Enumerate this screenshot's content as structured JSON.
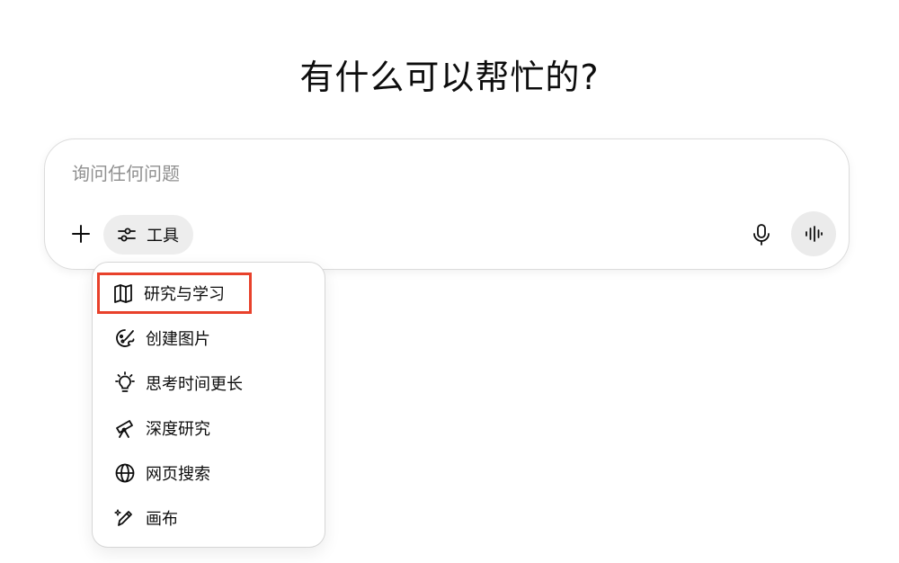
{
  "title": "有什么可以帮忙的?",
  "composer": {
    "placeholder": "询问任何问题",
    "value": "",
    "plus_icon": "plus-icon",
    "tools_label": "工具",
    "tools_icon": "sliders-icon",
    "mic_icon": "microphone-icon",
    "voice_icon": "voice-waveform-icon"
  },
  "tools_menu": {
    "items": [
      {
        "label": "研究与学习",
        "icon": "book-icon",
        "highlighted": true
      },
      {
        "label": "创建图片",
        "icon": "palette-icon"
      },
      {
        "label": "思考时间更长",
        "icon": "lightbulb-icon"
      },
      {
        "label": "深度研究",
        "icon": "telescope-icon"
      },
      {
        "label": "网页搜索",
        "icon": "globe-icon"
      },
      {
        "label": "画布",
        "icon": "pen-sparkle-icon"
      }
    ]
  },
  "colors": {
    "highlight_border": "#e8412b",
    "pill_background": "#ededed",
    "placeholder": "#8f8f8f"
  }
}
